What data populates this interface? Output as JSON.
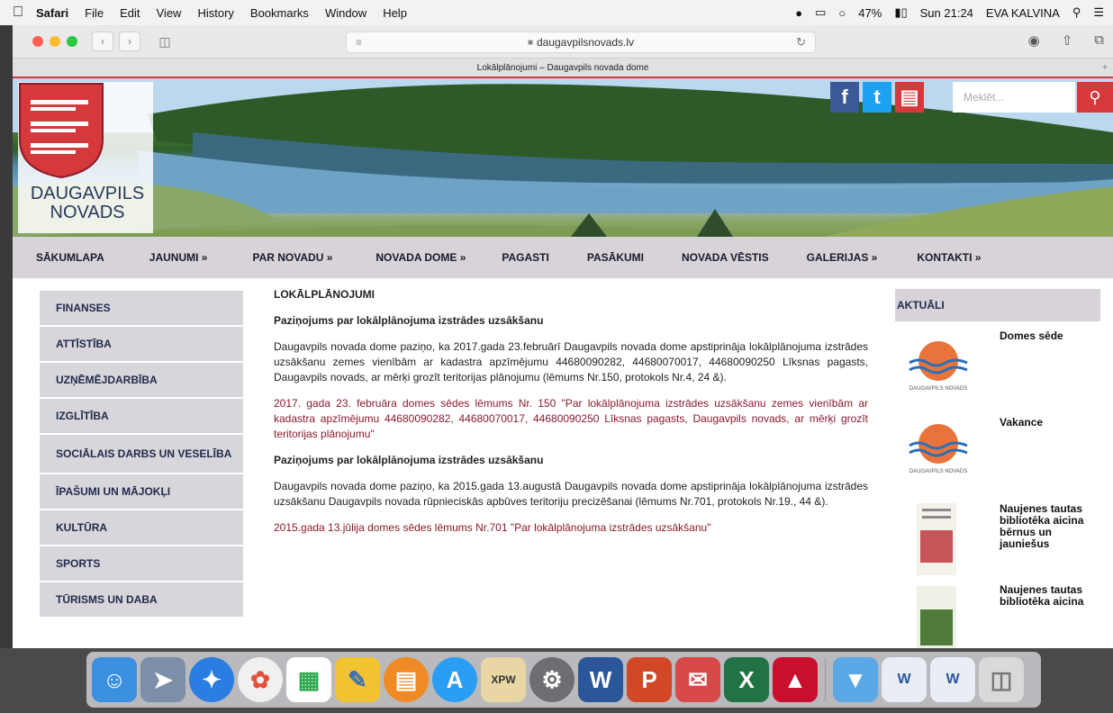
{
  "menubar": {
    "app": "Safari",
    "items": [
      "File",
      "Edit",
      "View",
      "History",
      "Bookmarks",
      "Window",
      "Help"
    ],
    "battery": "47%",
    "clock": "Sun 21:24",
    "user": "EVA KALVINA"
  },
  "browser": {
    "url": "daugavpilsnovads.lv",
    "tab_title": "Lokālplānojumi – Daugavpils novada dome"
  },
  "site": {
    "logo_line1": "DAUGAVPILS",
    "logo_line2": "NOVADS",
    "search_placeholder": "Meklēt...",
    "nav": [
      "SĀKUMLAPA",
      "JAUNUMI »",
      "PAR NOVADU »",
      "NOVADA DOME »",
      "PAGASTI",
      "PASĀKUMI",
      "NOVADA VĒSTIS",
      "GALERIJAS »",
      "KONTAKTI »"
    ],
    "left_menu": [
      "FINANSES",
      "ATTĪSTĪBA",
      "UZŅĒMĒJDARBĪBA",
      "IZGLĪTĪBA",
      "SOCIĀLAIS DARBS UN VESELĪBA",
      "ĪPAŠUMI UN MĀJOKĻI",
      "KULTŪRA",
      "SPORTS",
      "TŪRISMS UN DABA"
    ],
    "main": {
      "title": "LOKĀLPLĀNOJUMI",
      "h1": "Paziņojums par lokālplānojuma izstrādes uzsākšanu",
      "p1": "Daugavpils novada dome paziņo, ka 2017.gada 23.februārī Daugavpils novada dome apstiprināja lokālplānojuma izstrādes uzsākšanu zemes vienībām ar kadastra apzīmējumu 44680090282, 44680070017, 44680090250 Līksnas pagasts, Daugavpils novads, ar mērķi grozīt teritorijas plānojumu (lēmums Nr.150, protokols Nr.4, 24 &).",
      "link1": "2017. gada 23. februāra domes sēdes lēmums Nr. 150 \"Par lokālplānojuma izstrādes uzsākšanu zemes vienībām ar kadastra apzīmējumu 44680090282, 44680070017, 44680090250 Līksnas pagasts, Daugavpils novads, ar mērķi grozīt teritorijas plānojumu\"",
      "h2": "Paziņojums par lokālplānojuma izstrādes uzsākšanu",
      "p2": "Daugavpils novada dome paziņo, ka 2015.gada 13.augustā Daugavpils novada dome apstiprināja lokālplānojuma izstrādes uzsākšanu Daugavpils novada rūpnieciskās apbūves teritoriju precizēšanai (lēmums Nr.701, protokols Nr.19., 44 &).",
      "link2": "2015.gada 13.jūlija domes sēdes lēmums Nr.701 \"Par lokālplānojuma izstrādes uzsākšanu\""
    },
    "aside": {
      "title": "AKTUĀLI",
      "items": [
        "Domes sēde",
        "Vakance",
        "Naujenes tautas bibliotēka aicina bērnus un jauniešus",
        "Naujenes tautas bibliotēka aicina"
      ],
      "thumb_caption": "DAUGAVPILS NOVADS"
    }
  },
  "colors": {
    "accent": "#d6393b",
    "nav_bg": "#d7d3d9",
    "link": "#8b1a2a"
  }
}
